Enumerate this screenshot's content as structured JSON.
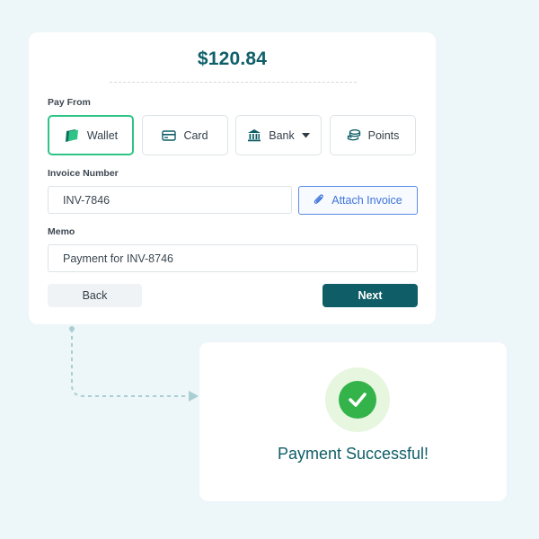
{
  "payment": {
    "amount": "$120.84",
    "pay_from_label": "Pay From",
    "methods": [
      {
        "label": "Wallet",
        "icon": "wallet-icon",
        "selected": true
      },
      {
        "label": "Card",
        "icon": "card-icon",
        "selected": false
      },
      {
        "label": "Bank",
        "icon": "bank-icon",
        "selected": false
      },
      {
        "label": "Points",
        "icon": "coins-icon",
        "selected": false
      }
    ],
    "invoice": {
      "label": "Invoice Number",
      "value": "INV-7846",
      "attach_label": "Attach Invoice"
    },
    "memo": {
      "label": "Memo",
      "value": "Payment for INV-8746"
    },
    "actions": {
      "back_label": "Back",
      "next_label": "Next"
    }
  },
  "success": {
    "message": "Payment Successful!"
  },
  "colors": {
    "accent": "#0f5d67",
    "selected_border": "#2ec486",
    "success_green": "#34b34b",
    "attach_blue": "#3f74d9"
  }
}
